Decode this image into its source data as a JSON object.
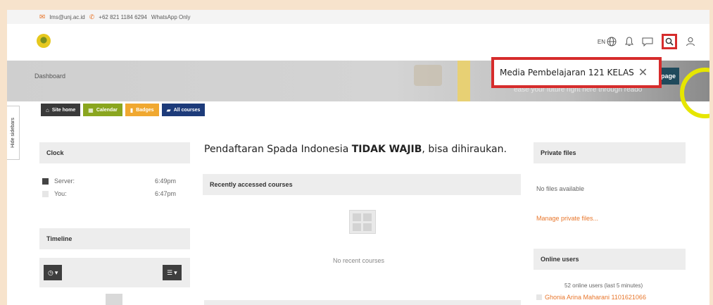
{
  "topbar": {
    "email": "lms@unj.ac.id",
    "phone": "+62 821 1184 6294",
    "whatsapp": "WhatsApp Only"
  },
  "navbar": {
    "language": "EN",
    "icons": [
      "globe-icon",
      "bell-icon",
      "chat-icon",
      "search-icon",
      "user-icon"
    ]
  },
  "hero": {
    "breadcrumb": "Dashboard",
    "page_button_label": "page",
    "overlay_text": "ease your future right here through reado"
  },
  "search_popup": {
    "query": "Media Pembelajaran 121 KELAS",
    "close_icon": "close-icon"
  },
  "hide_sidebar_label": "Hide sidebars",
  "quick_links": [
    {
      "label": "Site home",
      "icon": "home-icon",
      "color": "#3a3a3a"
    },
    {
      "label": "Calendar",
      "icon": "calendar-icon",
      "color": "#8aa61f"
    },
    {
      "label": "Badges",
      "icon": "bookmark-icon",
      "color": "#f0a830"
    },
    {
      "label": "All courses",
      "icon": "book-icon",
      "color": "#1d3b7a"
    }
  ],
  "clock": {
    "title": "Clock",
    "server_label": "Server:",
    "server_time": "6:49pm",
    "you_label": "You:",
    "you_time": "6:47pm"
  },
  "timeline": {
    "title": "Timeline"
  },
  "main": {
    "headline_prefix": "Pendaftaran Spada Indonesia ",
    "headline_bold": "TIDAK WAJIB",
    "headline_suffix": ", bisa dihiraukan.",
    "recent_title": "Recently accessed courses",
    "recent_empty": "No recent courses"
  },
  "private_files": {
    "title": "Private files",
    "empty": "No files available",
    "manage_link": "Manage private files..."
  },
  "online_users": {
    "title": "Online users",
    "summary": "52 online users (last 5 minutes)",
    "first_user": "Ghonia Arina Maharani 1101621066"
  },
  "colors": {
    "accent": "#e8762b",
    "highlight": "#d62c2c"
  }
}
